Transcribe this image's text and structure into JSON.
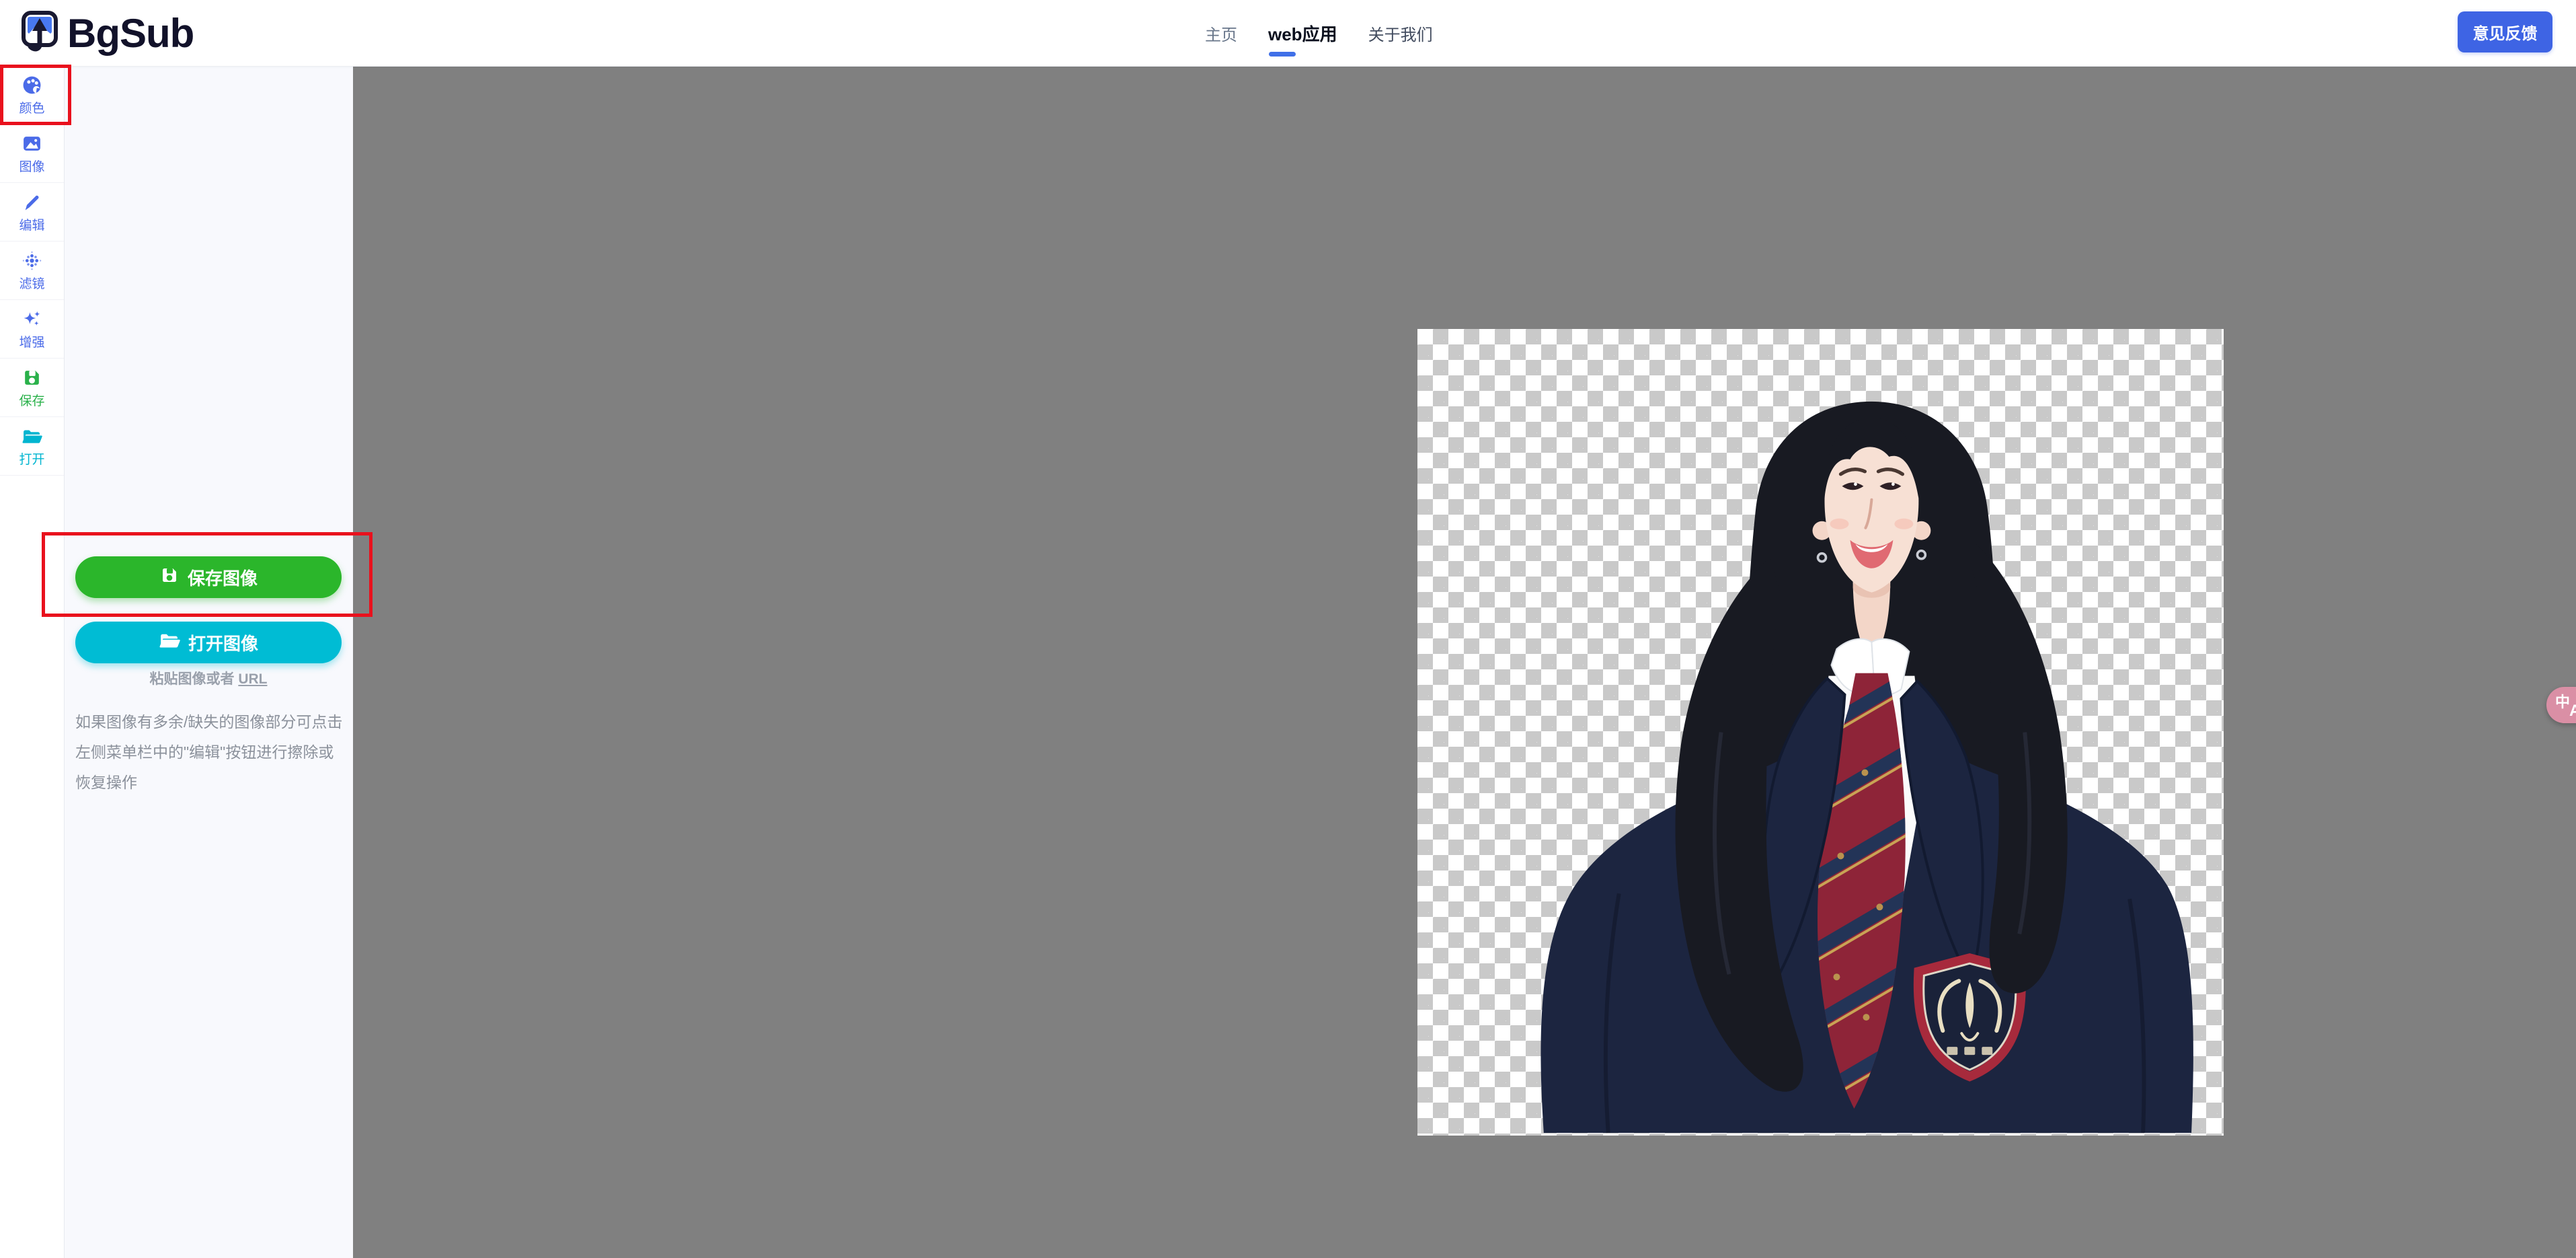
{
  "app": {
    "name": "BgSub"
  },
  "header": {
    "logo_text": "BgSub",
    "nav": {
      "home": "主页",
      "webapp": "web应用",
      "about": "关于我们"
    },
    "feedback_button": "意见反馈"
  },
  "toolbar": {
    "color": "颜色",
    "image": "图像",
    "edit": "编辑",
    "filter": "滤镜",
    "enhance": "增强",
    "save": "保存",
    "open": "打开"
  },
  "panel": {
    "save_image_button": "保存图像",
    "open_image_button": "打开图像",
    "paste_hint_prefix": "粘贴图像或者 ",
    "paste_hint_link": "URL",
    "tip": "如果图像有多余/缺失的图像部分可点击左侧菜单栏中的\"编辑\"按钮进行擦除或恢复操作"
  },
  "translate_widget": {
    "zh": "中",
    "en": "A"
  },
  "colors": {
    "accent_blue": "#3e64e4",
    "icon_blue": "#4b6be8",
    "save_green": "#2bb62b",
    "open_cyan": "#00bcd4",
    "annotation_red": "#e9111d",
    "canvas_gray": "#808080",
    "checker_gray": "#c9c9c9",
    "panel_bg": "#f8f9fd"
  }
}
